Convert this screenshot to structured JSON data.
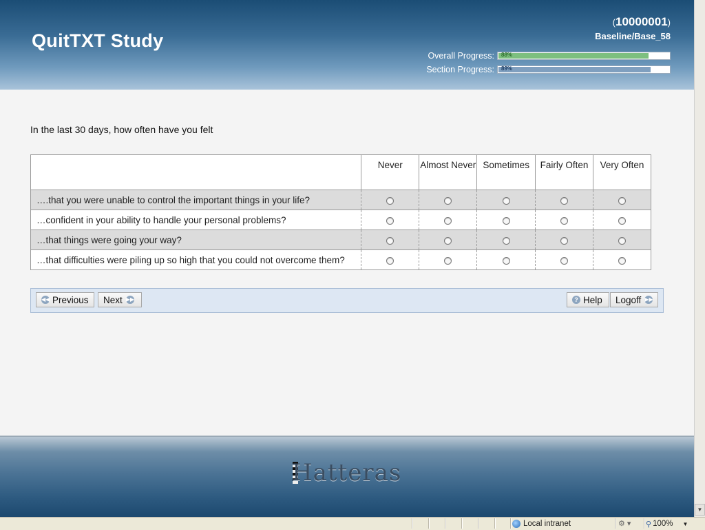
{
  "header": {
    "study_title": "QuitTXT Study",
    "participant_id": "10000001",
    "section": "Baseline/Base_58",
    "overall_label": "Overall Progress:",
    "overall_value": "88%",
    "overall_fraction": 0.88,
    "section_label": "Section Progress:",
    "section_value": "89%",
    "section_fraction": 0.89
  },
  "question": {
    "prompt": "In the last 30 days, how often have you felt",
    "columns": [
      "Never",
      "Almost Never",
      "Sometimes",
      "Fairly Often",
      "Very Often"
    ],
    "items": [
      "….that you were unable to control the important things in your life?",
      "…confident in your ability to handle your personal problems?",
      "…that things were going your way?",
      "…that difficulties were piling up so high that you could not overcome them?"
    ]
  },
  "nav": {
    "previous": "Previous",
    "next": "Next",
    "help": "Help",
    "logoff": "Logoff"
  },
  "footer": {
    "logo": "Hatteras"
  },
  "status": {
    "zone": "Local intranet",
    "zoom": "100%"
  },
  "icons": {
    "previous": "rewind-icon",
    "next": "fast-forward-icon",
    "help": "help-icon",
    "logoff": "fast-forward-icon"
  },
  "colors": {
    "header_dark": "#1b4d75",
    "overall_fill": "#7dbf7f",
    "section_fill": "#7f9fbf",
    "nav_bg": "#dde7f3"
  }
}
